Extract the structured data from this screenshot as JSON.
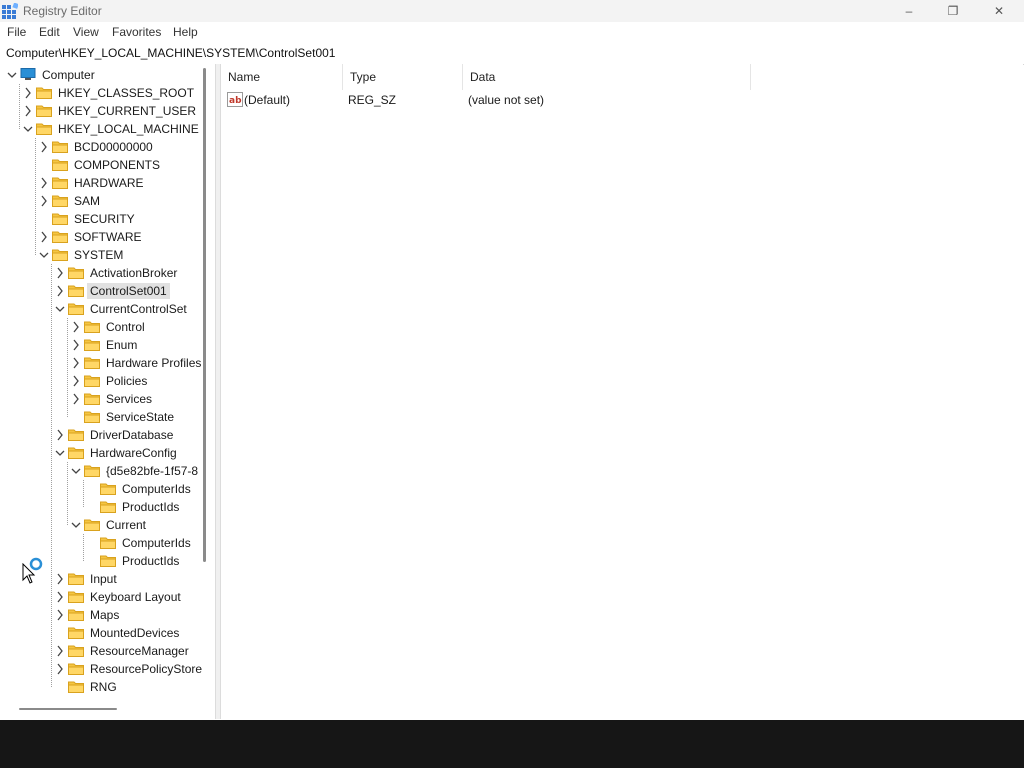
{
  "window": {
    "title": "Registry Editor",
    "controls": {
      "minimize": "–",
      "maximize": "❐",
      "close": "✕"
    }
  },
  "menu": [
    "File",
    "Edit",
    "View",
    "Favorites",
    "Help"
  ],
  "address": "Computer\\HKEY_LOCAL_MACHINE\\SYSTEM\\ControlSet001",
  "tree": [
    {
      "label": "Computer",
      "depth": 0,
      "expander": "expanded",
      "icon": "computer-icon"
    },
    {
      "label": "HKEY_CLASSES_ROOT",
      "depth": 1,
      "expander": "collapsed",
      "icon": "folder-icon"
    },
    {
      "label": "HKEY_CURRENT_USER",
      "depth": 1,
      "expander": "collapsed",
      "icon": "folder-icon"
    },
    {
      "label": "HKEY_LOCAL_MACHINE",
      "depth": 1,
      "expander": "expanded",
      "icon": "folder-icon"
    },
    {
      "label": "BCD00000000",
      "depth": 2,
      "expander": "collapsed",
      "icon": "folder-icon"
    },
    {
      "label": "COMPONENTS",
      "depth": 2,
      "expander": "none",
      "icon": "folder-icon"
    },
    {
      "label": "HARDWARE",
      "depth": 2,
      "expander": "collapsed",
      "icon": "folder-icon"
    },
    {
      "label": "SAM",
      "depth": 2,
      "expander": "collapsed",
      "icon": "folder-icon"
    },
    {
      "label": "SECURITY",
      "depth": 2,
      "expander": "none",
      "icon": "folder-icon"
    },
    {
      "label": "SOFTWARE",
      "depth": 2,
      "expander": "collapsed",
      "icon": "folder-icon"
    },
    {
      "label": "SYSTEM",
      "depth": 2,
      "expander": "expanded",
      "icon": "folder-icon"
    },
    {
      "label": "ActivationBroker",
      "depth": 3,
      "expander": "collapsed",
      "icon": "folder-icon"
    },
    {
      "label": "ControlSet001",
      "depth": 3,
      "expander": "collapsed",
      "icon": "folder-icon",
      "selected": true
    },
    {
      "label": "CurrentControlSet",
      "depth": 3,
      "expander": "expanded",
      "icon": "folder-icon"
    },
    {
      "label": "Control",
      "depth": 4,
      "expander": "collapsed",
      "icon": "folder-icon"
    },
    {
      "label": "Enum",
      "depth": 4,
      "expander": "collapsed",
      "icon": "folder-icon"
    },
    {
      "label": "Hardware Profiles",
      "depth": 4,
      "expander": "collapsed",
      "icon": "folder-icon"
    },
    {
      "label": "Policies",
      "depth": 4,
      "expander": "collapsed",
      "icon": "folder-icon"
    },
    {
      "label": "Services",
      "depth": 4,
      "expander": "collapsed",
      "icon": "folder-icon"
    },
    {
      "label": "ServiceState",
      "depth": 4,
      "expander": "none",
      "icon": "folder-icon"
    },
    {
      "label": "DriverDatabase",
      "depth": 3,
      "expander": "collapsed",
      "icon": "folder-icon"
    },
    {
      "label": "HardwareConfig",
      "depth": 3,
      "expander": "expanded",
      "icon": "folder-icon"
    },
    {
      "label": "{d5e82bfe-1f57-8",
      "depth": 4,
      "expander": "expanded",
      "icon": "folder-icon"
    },
    {
      "label": "ComputerIds",
      "depth": 5,
      "expander": "none",
      "icon": "folder-icon"
    },
    {
      "label": "ProductIds",
      "depth": 5,
      "expander": "none",
      "icon": "folder-icon"
    },
    {
      "label": "Current",
      "depth": 4,
      "expander": "expanded",
      "icon": "folder-icon"
    },
    {
      "label": "ComputerIds",
      "depth": 5,
      "expander": "none",
      "icon": "folder-icon"
    },
    {
      "label": "ProductIds",
      "depth": 5,
      "expander": "none",
      "icon": "folder-icon"
    },
    {
      "label": "Input",
      "depth": 3,
      "expander": "collapsed",
      "icon": "folder-icon"
    },
    {
      "label": "Keyboard Layout",
      "depth": 3,
      "expander": "collapsed",
      "icon": "folder-icon"
    },
    {
      "label": "Maps",
      "depth": 3,
      "expander": "collapsed",
      "icon": "folder-icon"
    },
    {
      "label": "MountedDevices",
      "depth": 3,
      "expander": "none",
      "icon": "folder-icon"
    },
    {
      "label": "ResourceManager",
      "depth": 3,
      "expander": "collapsed",
      "icon": "folder-icon"
    },
    {
      "label": "ResourcePolicyStore",
      "depth": 3,
      "expander": "collapsed",
      "icon": "folder-icon"
    },
    {
      "label": "RNG",
      "depth": 3,
      "expander": "none",
      "icon": "folder-icon"
    }
  ],
  "columns": [
    "Name",
    "Type",
    "Data"
  ],
  "values": [
    {
      "name": "(Default)",
      "type": "REG_SZ",
      "data": "(value not set)",
      "icon": "string-value-icon"
    }
  ],
  "colors": {
    "selection": "#e1e1e1",
    "folder": "#f5c542",
    "computer": "#2a8fd6"
  }
}
